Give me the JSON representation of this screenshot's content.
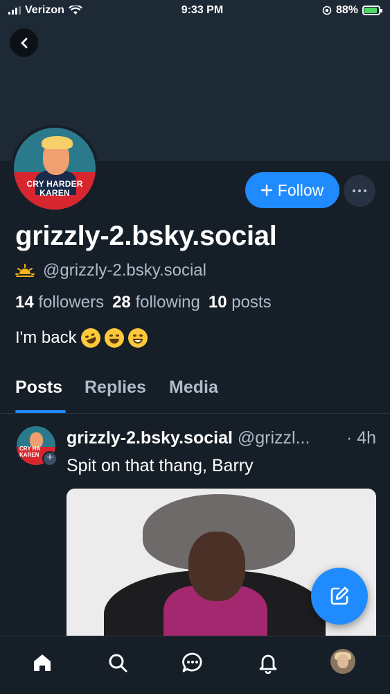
{
  "status_bar": {
    "carrier": "Verizon",
    "time": "9:33 PM",
    "battery": "88%"
  },
  "profile": {
    "avatar_caption_line1": "CRY HARDER",
    "avatar_caption_line2": "KAREN",
    "follow_label": "Follow",
    "display_name": "grizzly-2.bsky.social",
    "handle": "@grizzly-2.bsky.social",
    "followers_count": "14",
    "followers_label": "followers",
    "following_count": "28",
    "following_label": "following",
    "posts_count": "10",
    "posts_label": "posts",
    "bio": "I'm back"
  },
  "tabs": [
    {
      "label": "Posts",
      "active": true
    },
    {
      "label": "Replies",
      "active": false
    },
    {
      "label": "Media",
      "active": false
    }
  ],
  "post": {
    "author_name": "grizzly-2.bsky.social",
    "author_handle": "@grizzl...",
    "time": "· 4h",
    "text": "Spit on that thang, Barry"
  },
  "colors": {
    "accent": "#208bfe",
    "background": "#161e27",
    "banner": "#1e2936"
  },
  "icons": {
    "back": "chevron-left-icon",
    "more": "ellipsis-icon",
    "compose": "compose-icon",
    "nav": [
      "home-icon",
      "search-icon",
      "chat-icon",
      "bell-icon"
    ]
  }
}
